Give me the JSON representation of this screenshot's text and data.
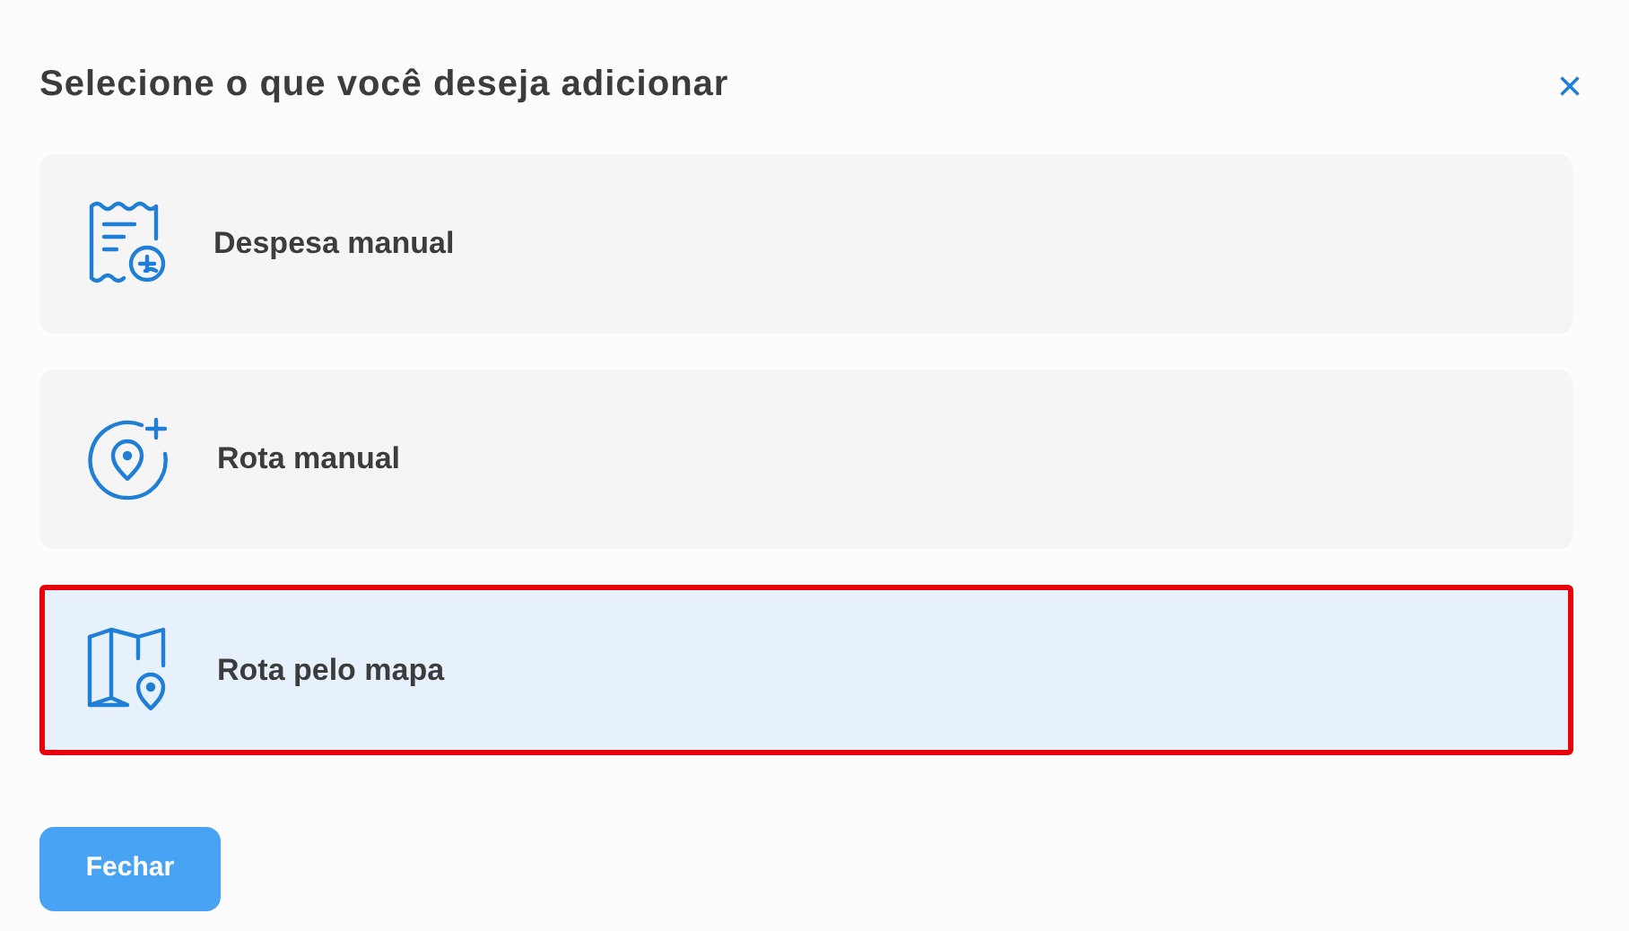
{
  "dialog": {
    "title": "Selecione o que você deseja adicionar",
    "close": "×"
  },
  "options": [
    {
      "kind": "expense",
      "label": "Despesa manual",
      "selected": false
    },
    {
      "kind": "route",
      "label": "Rota manual",
      "selected": false
    },
    {
      "kind": "map",
      "label": "Rota pelo mapa",
      "selected": true
    }
  ],
  "buttons": [
    {
      "label": "Fechar"
    }
  ]
}
